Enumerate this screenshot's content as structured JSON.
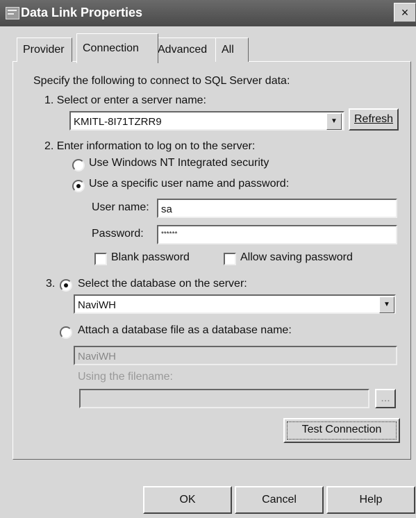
{
  "window": {
    "title": "Data Link Properties",
    "close_glyph": "×"
  },
  "tabs": [
    "Provider",
    "Connection",
    "Advanced",
    "All"
  ],
  "connection": {
    "intro": "Specify the following to connect to SQL Server data:",
    "step1_label": "1. Select or enter a server name:",
    "server_name": "KMITL-8I71TZRR9",
    "refresh_label": "Refresh",
    "step2_label": "2. Enter information to log on to the server:",
    "radio_nt_label": "Use Windows NT Integrated security",
    "radio_specific_label": "Use a specific user name and password:",
    "username_label": "User name:",
    "username_value": "sa",
    "password_label": "Password:",
    "password_value": "******",
    "blank_password_label": "Blank password",
    "allow_saving_label": "Allow saving password",
    "step3_prefix": "3.",
    "select_db_label": "Select the database on the server:",
    "database_value": "NaviWH",
    "attach_label": "Attach a database file as a database name:",
    "attach_name_value": "NaviWH",
    "using_filename_label": "Using the filename:",
    "browse_label": "...",
    "test_connection_label": "Test Connection"
  },
  "buttons": {
    "ok": "OK",
    "cancel": "Cancel",
    "help": "Help"
  },
  "state": {
    "active_tab": "Connection",
    "logon_mode": "specific",
    "db_mode": "select",
    "blank_password": false,
    "allow_saving_password": false
  }
}
